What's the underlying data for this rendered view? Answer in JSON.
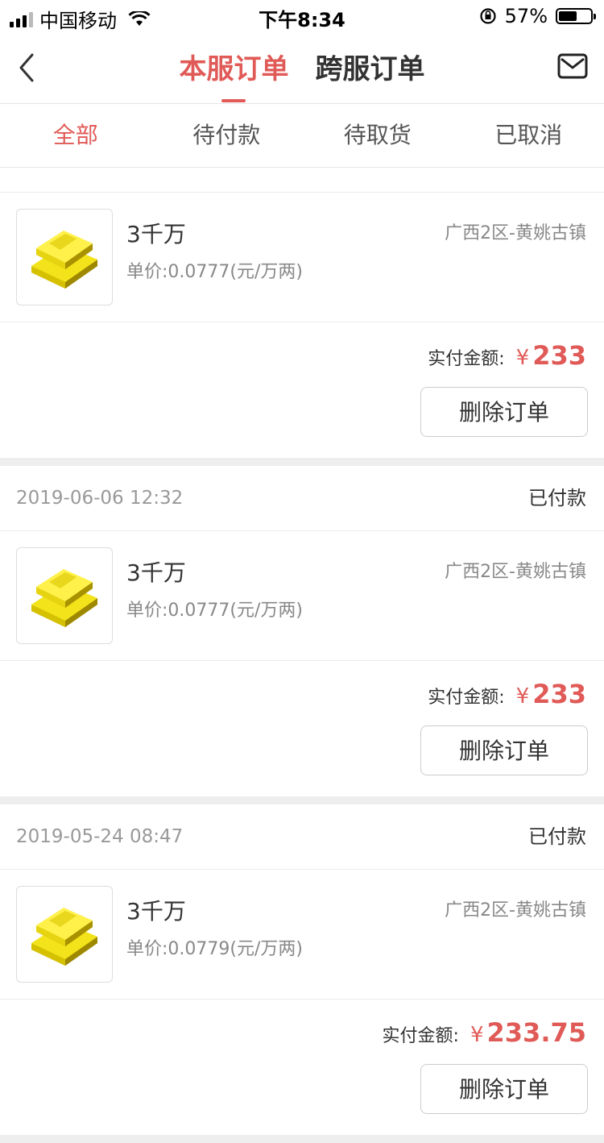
{
  "status_bar": {
    "carrier": "中国移动",
    "time": "下午8:34",
    "battery": "57%",
    "battery_level": 0.57
  },
  "nav": {
    "tabs": [
      "本服订单",
      "跨服订单"
    ],
    "active_tab": 0
  },
  "filters": {
    "items": [
      "全部",
      "待付款",
      "待取货",
      "已取消"
    ],
    "active": 0
  },
  "paid_label": "实付金额:",
  "currency": "¥",
  "delete_label": "删除订单",
  "orders": [
    {
      "date": "",
      "status": "",
      "name": "3千万",
      "unit_price": "单价:0.0777(元/万两)",
      "region": "广西2区-黄姚古镇",
      "amount": "233"
    },
    {
      "date": "2019-06-06 12:32",
      "status": "已付款",
      "name": "3千万",
      "unit_price": "单价:0.0777(元/万两)",
      "region": "广西2区-黄姚古镇",
      "amount": "233"
    },
    {
      "date": "2019-05-24 08:47",
      "status": "已付款",
      "name": "3千万",
      "unit_price": "单价:0.0779(元/万两)",
      "region": "广西2区-黄姚古镇",
      "amount": "233.75"
    }
  ],
  "icons": {
    "back": "chevron-left-icon",
    "mail": "envelope-icon",
    "thumb": "gold-bars-icon"
  },
  "colors": {
    "accent": "#e05a57"
  }
}
